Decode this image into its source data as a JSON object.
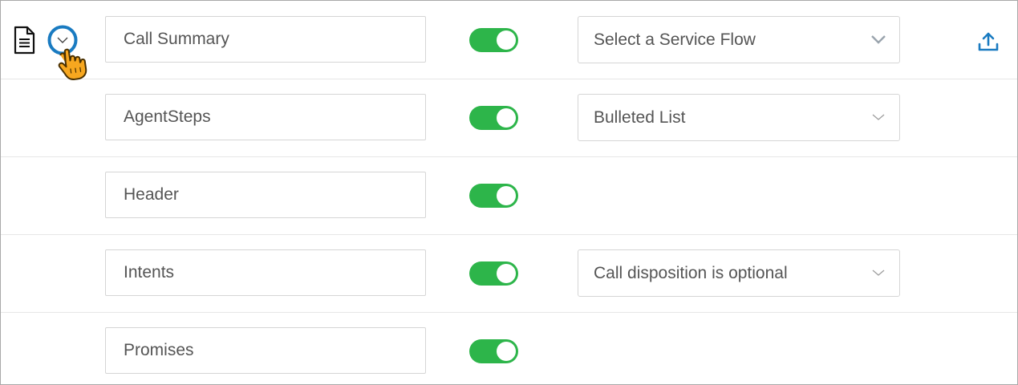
{
  "colors": {
    "toggle_on": "#2db54a",
    "accent_blue": "#1a7bc1",
    "field_border": "#d5d5d5",
    "text": "#555555"
  },
  "rows": [
    {
      "name": "Call Summary",
      "toggle_on": true,
      "select": {
        "value": "Select a Service Flow"
      }
    },
    {
      "name": "AgentSteps",
      "toggle_on": true,
      "select": {
        "value": "Bulleted List"
      }
    },
    {
      "name": "Header",
      "toggle_on": true
    },
    {
      "name": "Intents",
      "toggle_on": true,
      "select": {
        "value": "Call disposition is optional"
      }
    },
    {
      "name": "Promises",
      "toggle_on": true
    }
  ],
  "icons": {
    "document": "document-icon",
    "expand": "chevron-down-icon",
    "upload": "upload-icon",
    "cursor": "hand-pointer-icon"
  }
}
